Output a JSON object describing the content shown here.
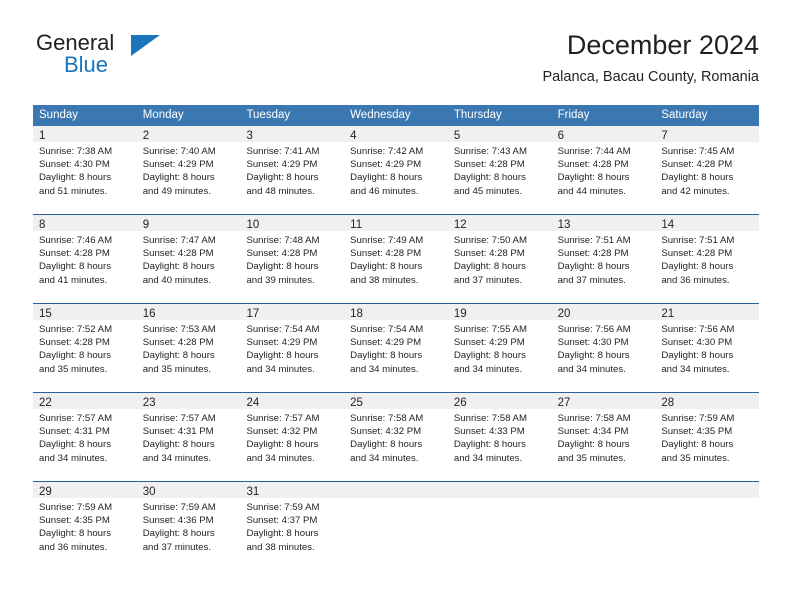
{
  "brand": {
    "name_part1": "General",
    "name_part2": "Blue",
    "logo_icon": "blue-triangle-icon",
    "accent_color": "#1b75bb"
  },
  "header": {
    "title": "December 2024",
    "subtitle": "Palanca, Bacau County, Romania"
  },
  "theme": {
    "header_blue": "#3b78b2",
    "row_divider_blue": "#2a6099",
    "day_band_gray": "#f0f0f0",
    "text_color": "#231f20"
  },
  "calendar": {
    "weekday_headers": [
      "Sunday",
      "Monday",
      "Tuesday",
      "Wednesday",
      "Thursday",
      "Friday",
      "Saturday"
    ],
    "weeks": [
      [
        {
          "day": "1",
          "sunrise": "Sunrise: 7:38 AM",
          "sunset": "Sunset: 4:30 PM",
          "daylight_line1": "Daylight: 8 hours",
          "daylight_line2": "and 51 minutes."
        },
        {
          "day": "2",
          "sunrise": "Sunrise: 7:40 AM",
          "sunset": "Sunset: 4:29 PM",
          "daylight_line1": "Daylight: 8 hours",
          "daylight_line2": "and 49 minutes."
        },
        {
          "day": "3",
          "sunrise": "Sunrise: 7:41 AM",
          "sunset": "Sunset: 4:29 PM",
          "daylight_line1": "Daylight: 8 hours",
          "daylight_line2": "and 48 minutes."
        },
        {
          "day": "4",
          "sunrise": "Sunrise: 7:42 AM",
          "sunset": "Sunset: 4:29 PM",
          "daylight_line1": "Daylight: 8 hours",
          "daylight_line2": "and 46 minutes."
        },
        {
          "day": "5",
          "sunrise": "Sunrise: 7:43 AM",
          "sunset": "Sunset: 4:28 PM",
          "daylight_line1": "Daylight: 8 hours",
          "daylight_line2": "and 45 minutes."
        },
        {
          "day": "6",
          "sunrise": "Sunrise: 7:44 AM",
          "sunset": "Sunset: 4:28 PM",
          "daylight_line1": "Daylight: 8 hours",
          "daylight_line2": "and 44 minutes."
        },
        {
          "day": "7",
          "sunrise": "Sunrise: 7:45 AM",
          "sunset": "Sunset: 4:28 PM",
          "daylight_line1": "Daylight: 8 hours",
          "daylight_line2": "and 42 minutes."
        }
      ],
      [
        {
          "day": "8",
          "sunrise": "Sunrise: 7:46 AM",
          "sunset": "Sunset: 4:28 PM",
          "daylight_line1": "Daylight: 8 hours",
          "daylight_line2": "and 41 minutes."
        },
        {
          "day": "9",
          "sunrise": "Sunrise: 7:47 AM",
          "sunset": "Sunset: 4:28 PM",
          "daylight_line1": "Daylight: 8 hours",
          "daylight_line2": "and 40 minutes."
        },
        {
          "day": "10",
          "sunrise": "Sunrise: 7:48 AM",
          "sunset": "Sunset: 4:28 PM",
          "daylight_line1": "Daylight: 8 hours",
          "daylight_line2": "and 39 minutes."
        },
        {
          "day": "11",
          "sunrise": "Sunrise: 7:49 AM",
          "sunset": "Sunset: 4:28 PM",
          "daylight_line1": "Daylight: 8 hours",
          "daylight_line2": "and 38 minutes."
        },
        {
          "day": "12",
          "sunrise": "Sunrise: 7:50 AM",
          "sunset": "Sunset: 4:28 PM",
          "daylight_line1": "Daylight: 8 hours",
          "daylight_line2": "and 37 minutes."
        },
        {
          "day": "13",
          "sunrise": "Sunrise: 7:51 AM",
          "sunset": "Sunset: 4:28 PM",
          "daylight_line1": "Daylight: 8 hours",
          "daylight_line2": "and 37 minutes."
        },
        {
          "day": "14",
          "sunrise": "Sunrise: 7:51 AM",
          "sunset": "Sunset: 4:28 PM",
          "daylight_line1": "Daylight: 8 hours",
          "daylight_line2": "and 36 minutes."
        }
      ],
      [
        {
          "day": "15",
          "sunrise": "Sunrise: 7:52 AM",
          "sunset": "Sunset: 4:28 PM",
          "daylight_line1": "Daylight: 8 hours",
          "daylight_line2": "and 35 minutes."
        },
        {
          "day": "16",
          "sunrise": "Sunrise: 7:53 AM",
          "sunset": "Sunset: 4:28 PM",
          "daylight_line1": "Daylight: 8 hours",
          "daylight_line2": "and 35 minutes."
        },
        {
          "day": "17",
          "sunrise": "Sunrise: 7:54 AM",
          "sunset": "Sunset: 4:29 PM",
          "daylight_line1": "Daylight: 8 hours",
          "daylight_line2": "and 34 minutes."
        },
        {
          "day": "18",
          "sunrise": "Sunrise: 7:54 AM",
          "sunset": "Sunset: 4:29 PM",
          "daylight_line1": "Daylight: 8 hours",
          "daylight_line2": "and 34 minutes."
        },
        {
          "day": "19",
          "sunrise": "Sunrise: 7:55 AM",
          "sunset": "Sunset: 4:29 PM",
          "daylight_line1": "Daylight: 8 hours",
          "daylight_line2": "and 34 minutes."
        },
        {
          "day": "20",
          "sunrise": "Sunrise: 7:56 AM",
          "sunset": "Sunset: 4:30 PM",
          "daylight_line1": "Daylight: 8 hours",
          "daylight_line2": "and 34 minutes."
        },
        {
          "day": "21",
          "sunrise": "Sunrise: 7:56 AM",
          "sunset": "Sunset: 4:30 PM",
          "daylight_line1": "Daylight: 8 hours",
          "daylight_line2": "and 34 minutes."
        }
      ],
      [
        {
          "day": "22",
          "sunrise": "Sunrise: 7:57 AM",
          "sunset": "Sunset: 4:31 PM",
          "daylight_line1": "Daylight: 8 hours",
          "daylight_line2": "and 34 minutes."
        },
        {
          "day": "23",
          "sunrise": "Sunrise: 7:57 AM",
          "sunset": "Sunset: 4:31 PM",
          "daylight_line1": "Daylight: 8 hours",
          "daylight_line2": "and 34 minutes."
        },
        {
          "day": "24",
          "sunrise": "Sunrise: 7:57 AM",
          "sunset": "Sunset: 4:32 PM",
          "daylight_line1": "Daylight: 8 hours",
          "daylight_line2": "and 34 minutes."
        },
        {
          "day": "25",
          "sunrise": "Sunrise: 7:58 AM",
          "sunset": "Sunset: 4:32 PM",
          "daylight_line1": "Daylight: 8 hours",
          "daylight_line2": "and 34 minutes."
        },
        {
          "day": "26",
          "sunrise": "Sunrise: 7:58 AM",
          "sunset": "Sunset: 4:33 PM",
          "daylight_line1": "Daylight: 8 hours",
          "daylight_line2": "and 34 minutes."
        },
        {
          "day": "27",
          "sunrise": "Sunrise: 7:58 AM",
          "sunset": "Sunset: 4:34 PM",
          "daylight_line1": "Daylight: 8 hours",
          "daylight_line2": "and 35 minutes."
        },
        {
          "day": "28",
          "sunrise": "Sunrise: 7:59 AM",
          "sunset": "Sunset: 4:35 PM",
          "daylight_line1": "Daylight: 8 hours",
          "daylight_line2": "and 35 minutes."
        }
      ],
      [
        {
          "day": "29",
          "sunrise": "Sunrise: 7:59 AM",
          "sunset": "Sunset: 4:35 PM",
          "daylight_line1": "Daylight: 8 hours",
          "daylight_line2": "and 36 minutes."
        },
        {
          "day": "30",
          "sunrise": "Sunrise: 7:59 AM",
          "sunset": "Sunset: 4:36 PM",
          "daylight_line1": "Daylight: 8 hours",
          "daylight_line2": "and 37 minutes."
        },
        {
          "day": "31",
          "sunrise": "Sunrise: 7:59 AM",
          "sunset": "Sunset: 4:37 PM",
          "daylight_line1": "Daylight: 8 hours",
          "daylight_line2": "and 38 minutes."
        },
        {
          "day": "",
          "sunrise": "",
          "sunset": "",
          "daylight_line1": "",
          "daylight_line2": ""
        },
        {
          "day": "",
          "sunrise": "",
          "sunset": "",
          "daylight_line1": "",
          "daylight_line2": ""
        },
        {
          "day": "",
          "sunrise": "",
          "sunset": "",
          "daylight_line1": "",
          "daylight_line2": ""
        },
        {
          "day": "",
          "sunrise": "",
          "sunset": "",
          "daylight_line1": "",
          "daylight_line2": ""
        }
      ]
    ]
  }
}
